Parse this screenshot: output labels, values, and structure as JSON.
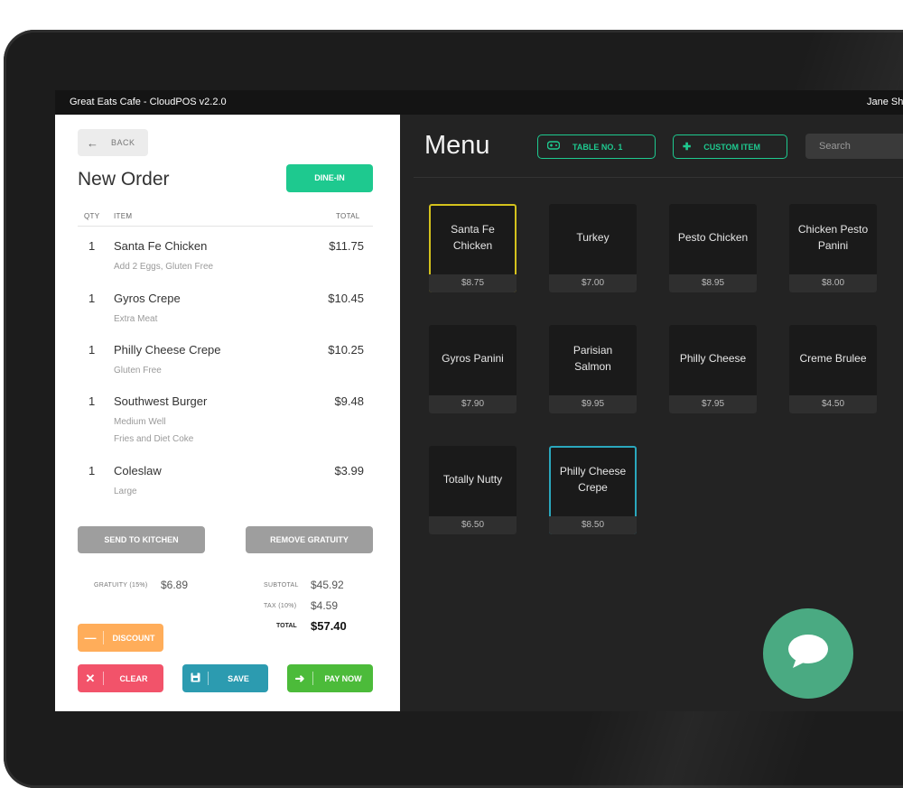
{
  "titlebar": {
    "app_title": "Great Eats Cafe - CloudPOS v2.2.0",
    "user": "Jane Sh"
  },
  "order": {
    "back_label": "BACK",
    "title": "New Order",
    "dine_in_label": "DINE-IN",
    "columns": {
      "qty": "QTY",
      "item": "ITEM",
      "total": "TOTAL"
    },
    "items": [
      {
        "qty": "1",
        "name": "Santa Fe Chicken",
        "price": "$11.75",
        "modifiers": [
          "Add 2 Eggs, Gluten Free"
        ]
      },
      {
        "qty": "1",
        "name": "Gyros Crepe",
        "price": "$10.45",
        "modifiers": [
          "Extra Meat"
        ]
      },
      {
        "qty": "1",
        "name": "Philly Cheese Crepe",
        "price": "$10.25",
        "modifiers": [
          "Gluten Free"
        ]
      },
      {
        "qty": "1",
        "name": "Southwest Burger",
        "price": "$9.48",
        "modifiers": [
          "Medium Well",
          "Fries and Diet Coke"
        ]
      },
      {
        "qty": "1",
        "name": "Coleslaw",
        "price": "$3.99",
        "modifiers": [
          "Large"
        ]
      }
    ],
    "send_to_kitchen_label": "SEND TO KITCHEN",
    "remove_gratuity_label": "REMOVE GRATUITY",
    "gratuity_label": "GRATUITY (15%)",
    "gratuity_value": "$6.89",
    "subtotal_label": "SUBTOTAL",
    "subtotal_value": "$45.92",
    "tax_label": "TAX (10%)",
    "tax_value": "$4.59",
    "total_label": "TOTAL",
    "total_value": "$57.40",
    "discount_label": "DISCOUNT",
    "clear_label": "CLEAR",
    "save_label": "SAVE",
    "pay_now_label": "PAY NOW"
  },
  "menu": {
    "title": "Menu",
    "table_label": "TABLE NO. 1",
    "custom_item_label": "CUSTOM ITEM",
    "search_placeholder": "Search",
    "items": [
      {
        "name": "Santa Fe Chicken",
        "price": "$8.75"
      },
      {
        "name": "Turkey",
        "price": "$7.00"
      },
      {
        "name": "Pesto Chicken",
        "price": "$8.95"
      },
      {
        "name": "Chicken Pesto Panini",
        "price": "$8.00"
      },
      {
        "name": "Gyros Panini",
        "price": "$7.90"
      },
      {
        "name": "Parisian Salmon",
        "price": "$9.95"
      },
      {
        "name": "Philly Cheese",
        "price": "$7.95"
      },
      {
        "name": "Creme Brulee",
        "price": "$4.50"
      },
      {
        "name": "Totally Nutty",
        "price": "$6.50"
      },
      {
        "name": "Philly Cheese Crepe",
        "price": "$8.50"
      }
    ]
  },
  "colors": {
    "accent_green": "#1ec98f",
    "discount_orange": "#ffad5a",
    "clear_red": "#f2536a",
    "save_teal": "#2c9bb0",
    "pay_green": "#4cbb3a",
    "selected_yellow": "#d4c21d",
    "selected_teal": "#2aa7bd",
    "chat_green": "#4aaa82"
  },
  "icons": {
    "back": "arrow-left-icon",
    "table": "gamepad-icon",
    "custom_item": "plus-icon",
    "discount": "minus-icon",
    "clear": "close-icon",
    "save": "floppy-disk-icon",
    "pay": "arrow-right-icon",
    "chat": "chat-bubble-icon"
  }
}
